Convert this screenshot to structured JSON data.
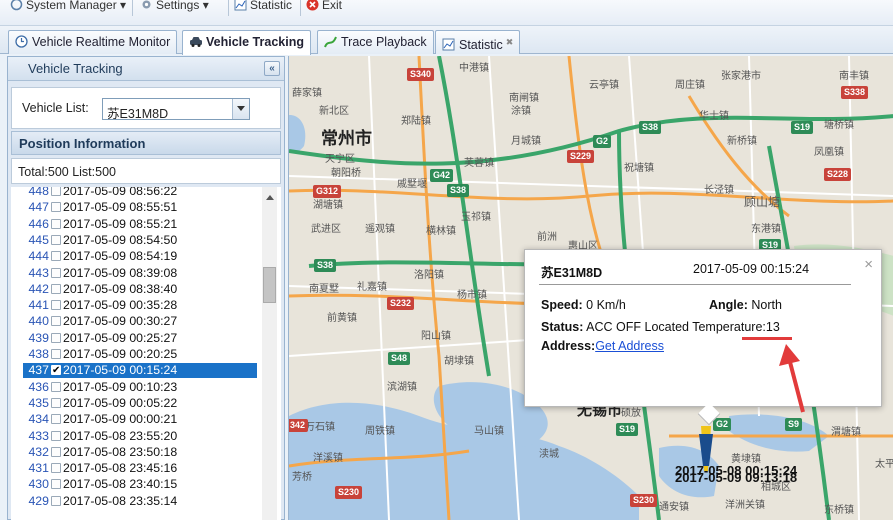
{
  "menu": {
    "system_manager": "System Manager",
    "settings": "Settings",
    "statistic": "Statistic",
    "exit": "Exit"
  },
  "tabs": [
    {
      "label": "Vehicle Realtime Monitor",
      "icon": "clock-icon"
    },
    {
      "label": "Vehicle Tracking",
      "icon": "car-icon",
      "active": true
    },
    {
      "label": "Trace Playback",
      "icon": "route-icon"
    },
    {
      "label": "Statistic",
      "icon": "chart-icon",
      "closable": true
    }
  ],
  "left_panel": {
    "title": "Vehicle Tracking",
    "collapse_symbol": "«",
    "vehicle_list_label": "Vehicle List:",
    "vehicle_selected": "苏E31M8D",
    "position_info_title": "Position Information",
    "total_text": "Total:500 List:500"
  },
  "positions": [
    {
      "num": "448",
      "time": "2017-05-09 08:56:22"
    },
    {
      "num": "447",
      "time": "2017-05-09 08:55:51"
    },
    {
      "num": "446",
      "time": "2017-05-09 08:55:21"
    },
    {
      "num": "445",
      "time": "2017-05-09 08:54:50"
    },
    {
      "num": "444",
      "time": "2017-05-09 08:54:19"
    },
    {
      "num": "443",
      "time": "2017-05-09 08:39:08"
    },
    {
      "num": "442",
      "time": "2017-05-09 08:38:40"
    },
    {
      "num": "441",
      "time": "2017-05-09 00:35:28"
    },
    {
      "num": "440",
      "time": "2017-05-09 00:30:27"
    },
    {
      "num": "439",
      "time": "2017-05-09 00:25:27"
    },
    {
      "num": "438",
      "time": "2017-05-09 00:20:25"
    },
    {
      "num": "437",
      "time": "2017-05-09 00:15:24",
      "selected": true
    },
    {
      "num": "436",
      "time": "2017-05-09 00:10:23"
    },
    {
      "num": "435",
      "time": "2017-05-09 00:05:22"
    },
    {
      "num": "434",
      "time": "2017-05-09 00:00:21"
    },
    {
      "num": "433",
      "time": "2017-05-08 23:55:20"
    },
    {
      "num": "432",
      "time": "2017-05-08 23:50:18"
    },
    {
      "num": "431",
      "time": "2017-05-08 23:45:16"
    },
    {
      "num": "430",
      "time": "2017-05-08 23:40:15"
    },
    {
      "num": "429",
      "time": "2017-05-08 23:35:14"
    }
  ],
  "popup": {
    "vehicle": "苏E31M8D",
    "time": "2017-05-09 00:15:24",
    "speed_label": "Speed:",
    "speed_value": "0 Km/h",
    "angle_label": "Angle:",
    "angle_value": "North",
    "status_label": "Status:",
    "status_value": "ACC OFF Located Temperature:13",
    "address_label": "Address:",
    "address_link": "Get Address",
    "close_symbol": "×"
  },
  "map": {
    "city": "常州市",
    "city2": "无锡市",
    "marker_text_1": "2017-05-08 00:15:24",
    "marker_text_2": "2017-05-09 09:13:18",
    "labels": {
      "l1": "中港镇",
      "l2": "薛家镇",
      "l3": "新北区",
      "l4": "郑陆镇",
      "l5": "南闸镇",
      "l6": "涂镇",
      "l7": "华士镇",
      "l8": "塘桥镇",
      "l9": "天宁区",
      "l10": "朝阳桥",
      "l11": "芙蓉镇",
      "l12": "月城镇",
      "l13": "祝塘镇",
      "l14": "新桥镇",
      "l15": "凤凰镇",
      "l16": "湖塘镇",
      "l17": "戚墅堰",
      "l18": "玉祁镇",
      "l19": "长泾镇",
      "l20": "顾山塘",
      "l21": "东港镇",
      "l22": "武进区",
      "l23": "遥观镇",
      "l24": "横林镇",
      "l25": "前洲",
      "l26": "惠山区",
      "l27": "礼嘉镇",
      "l28": "洛阳镇",
      "l29": "南夏墅",
      "l30": "杨市镇",
      "l31": "前黄镇",
      "l32": "阳山镇",
      "l33": "胡埭镇",
      "l34": "滨湖镇",
      "l35": "马山镇",
      "l36": "湖塘镇",
      "l37": "渎城",
      "l38": "洋溪镇",
      "l39": "周铁镇",
      "l40": "芳桥",
      "l41": "万石镇",
      "l42": "张家港市",
      "l43": "南丰镇",
      "l44": "雪堰镇",
      "l45": "硕放",
      "l46": "鹅湖镇",
      "l47": "太平",
      "l48": "鹅山镇",
      "l49": "云亭镇",
      "l50": "周庄镇",
      "l51": "横山桥",
      "l52": "漕桥镇",
      "l53": "通安镇",
      "l54": "洋洲关镇",
      "l55": "渭塘镇",
      "l56": "黄埭镇",
      "l57": "相城区",
      "l58": "东桥镇"
    },
    "shields": {
      "s1": "S340",
      "s2": "S338",
      "s3": "S38",
      "s4": "G2",
      "s5": "S19",
      "s6": "S229",
      "s7": "G42",
      "s8": "S228",
      "s9": "G312",
      "s10": "S38",
      "s11": "S38",
      "s12": "S19",
      "s13": "S232",
      "s14": "S48",
      "s15": "S230",
      "s16": "G2",
      "s17": "S9",
      "s18": "S19",
      "s19": "S230",
      "s20": "342"
    }
  },
  "colors": {
    "selected_row": "#1a72c8",
    "link": "#1a4fd6",
    "annotation": "#e23b3b",
    "water": "#a9c8e6",
    "expressway_green": "#2e8b57",
    "road_orange": "#f5a64a"
  }
}
